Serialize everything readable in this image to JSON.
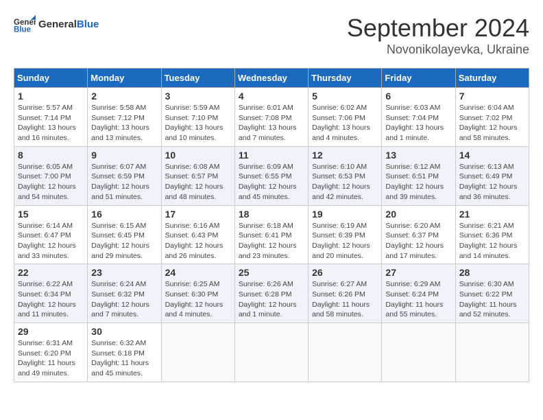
{
  "header": {
    "logo": {
      "general": "General",
      "blue": "Blue"
    },
    "title": "September 2024",
    "location": "Novonikolayevka, Ukraine"
  },
  "weekdays": [
    "Sunday",
    "Monday",
    "Tuesday",
    "Wednesday",
    "Thursday",
    "Friday",
    "Saturday"
  ],
  "weeks": [
    [
      {
        "day": 1,
        "info": "Sunrise: 5:57 AM\nSunset: 7:14 PM\nDaylight: 13 hours\nand 16 minutes."
      },
      {
        "day": 2,
        "info": "Sunrise: 5:58 AM\nSunset: 7:12 PM\nDaylight: 13 hours\nand 13 minutes."
      },
      {
        "day": 3,
        "info": "Sunrise: 5:59 AM\nSunset: 7:10 PM\nDaylight: 13 hours\nand 10 minutes."
      },
      {
        "day": 4,
        "info": "Sunrise: 6:01 AM\nSunset: 7:08 PM\nDaylight: 13 hours\nand 7 minutes."
      },
      {
        "day": 5,
        "info": "Sunrise: 6:02 AM\nSunset: 7:06 PM\nDaylight: 13 hours\nand 4 minutes."
      },
      {
        "day": 6,
        "info": "Sunrise: 6:03 AM\nSunset: 7:04 PM\nDaylight: 13 hours\nand 1 minute."
      },
      {
        "day": 7,
        "info": "Sunrise: 6:04 AM\nSunset: 7:02 PM\nDaylight: 12 hours\nand 58 minutes."
      }
    ],
    [
      {
        "day": 8,
        "info": "Sunrise: 6:05 AM\nSunset: 7:00 PM\nDaylight: 12 hours\nand 54 minutes."
      },
      {
        "day": 9,
        "info": "Sunrise: 6:07 AM\nSunset: 6:59 PM\nDaylight: 12 hours\nand 51 minutes."
      },
      {
        "day": 10,
        "info": "Sunrise: 6:08 AM\nSunset: 6:57 PM\nDaylight: 12 hours\nand 48 minutes."
      },
      {
        "day": 11,
        "info": "Sunrise: 6:09 AM\nSunset: 6:55 PM\nDaylight: 12 hours\nand 45 minutes."
      },
      {
        "day": 12,
        "info": "Sunrise: 6:10 AM\nSunset: 6:53 PM\nDaylight: 12 hours\nand 42 minutes."
      },
      {
        "day": 13,
        "info": "Sunrise: 6:12 AM\nSunset: 6:51 PM\nDaylight: 12 hours\nand 39 minutes."
      },
      {
        "day": 14,
        "info": "Sunrise: 6:13 AM\nSunset: 6:49 PM\nDaylight: 12 hours\nand 36 minutes."
      }
    ],
    [
      {
        "day": 15,
        "info": "Sunrise: 6:14 AM\nSunset: 6:47 PM\nDaylight: 12 hours\nand 33 minutes."
      },
      {
        "day": 16,
        "info": "Sunrise: 6:15 AM\nSunset: 6:45 PM\nDaylight: 12 hours\nand 29 minutes."
      },
      {
        "day": 17,
        "info": "Sunrise: 6:16 AM\nSunset: 6:43 PM\nDaylight: 12 hours\nand 26 minutes."
      },
      {
        "day": 18,
        "info": "Sunrise: 6:18 AM\nSunset: 6:41 PM\nDaylight: 12 hours\nand 23 minutes."
      },
      {
        "day": 19,
        "info": "Sunrise: 6:19 AM\nSunset: 6:39 PM\nDaylight: 12 hours\nand 20 minutes."
      },
      {
        "day": 20,
        "info": "Sunrise: 6:20 AM\nSunset: 6:37 PM\nDaylight: 12 hours\nand 17 minutes."
      },
      {
        "day": 21,
        "info": "Sunrise: 6:21 AM\nSunset: 6:36 PM\nDaylight: 12 hours\nand 14 minutes."
      }
    ],
    [
      {
        "day": 22,
        "info": "Sunrise: 6:22 AM\nSunset: 6:34 PM\nDaylight: 12 hours\nand 11 minutes."
      },
      {
        "day": 23,
        "info": "Sunrise: 6:24 AM\nSunset: 6:32 PM\nDaylight: 12 hours\nand 7 minutes."
      },
      {
        "day": 24,
        "info": "Sunrise: 6:25 AM\nSunset: 6:30 PM\nDaylight: 12 hours\nand 4 minutes."
      },
      {
        "day": 25,
        "info": "Sunrise: 6:26 AM\nSunset: 6:28 PM\nDaylight: 12 hours\nand 1 minute."
      },
      {
        "day": 26,
        "info": "Sunrise: 6:27 AM\nSunset: 6:26 PM\nDaylight: 11 hours\nand 58 minutes."
      },
      {
        "day": 27,
        "info": "Sunrise: 6:29 AM\nSunset: 6:24 PM\nDaylight: 11 hours\nand 55 minutes."
      },
      {
        "day": 28,
        "info": "Sunrise: 6:30 AM\nSunset: 6:22 PM\nDaylight: 11 hours\nand 52 minutes."
      }
    ],
    [
      {
        "day": 29,
        "info": "Sunrise: 6:31 AM\nSunset: 6:20 PM\nDaylight: 11 hours\nand 49 minutes."
      },
      {
        "day": 30,
        "info": "Sunrise: 6:32 AM\nSunset: 6:18 PM\nDaylight: 11 hours\nand 45 minutes."
      },
      null,
      null,
      null,
      null,
      null
    ]
  ]
}
